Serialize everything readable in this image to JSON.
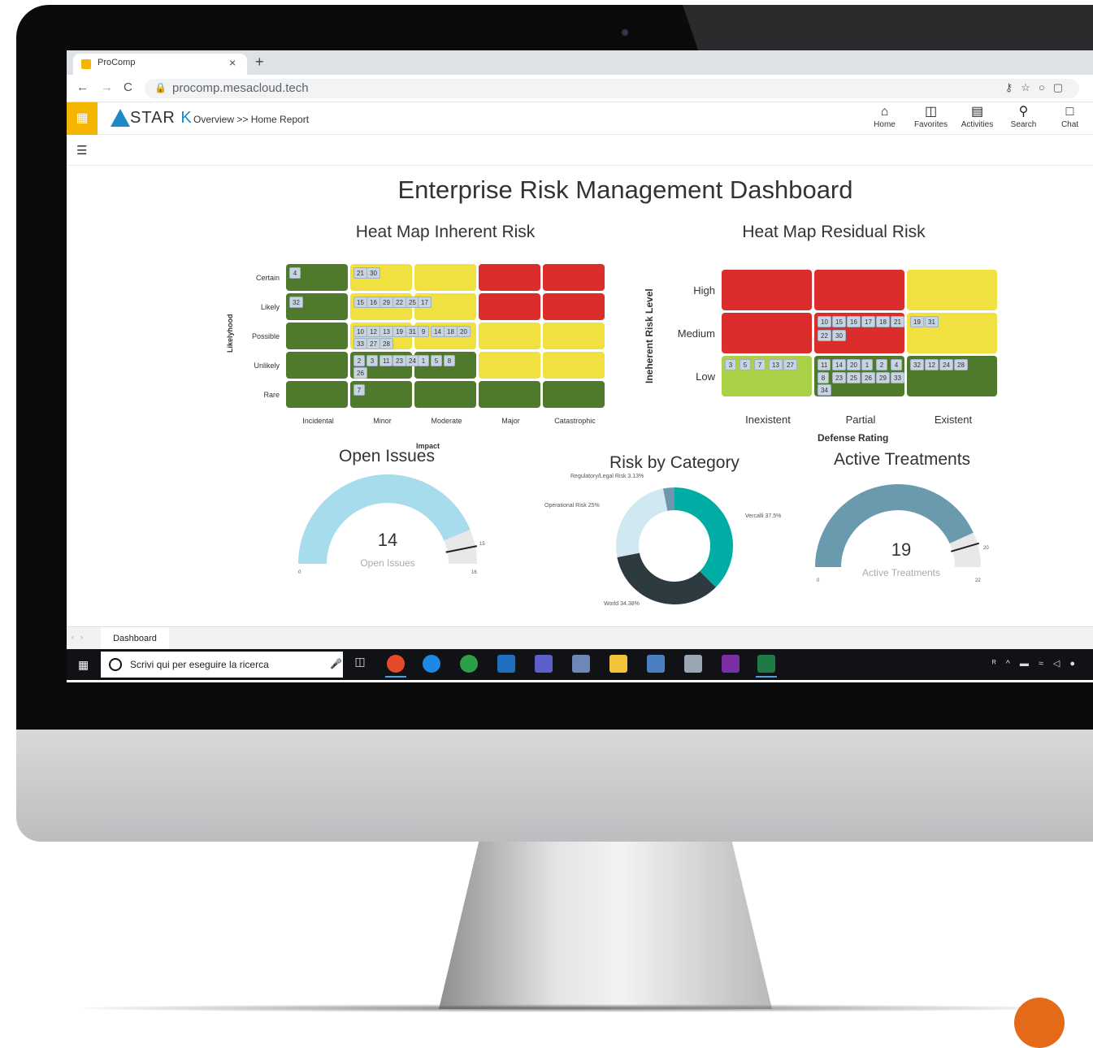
{
  "browser": {
    "tab_title": "ProComp",
    "tab_close": "×",
    "new_tab": "+",
    "url": "procomp.mesacloud.tech"
  },
  "app": {
    "logo_text": "STAR",
    "logo_k": "K",
    "breadcrumb": "Overview >> Home Report",
    "nav": [
      {
        "label": "Home",
        "icon": "home-icon"
      },
      {
        "label": "Favorites",
        "icon": "favorites-icon"
      },
      {
        "label": "Activities",
        "icon": "activities-icon"
      },
      {
        "label": "Search",
        "icon": "search-icon"
      },
      {
        "label": "Chat",
        "icon": "chat-icon"
      }
    ]
  },
  "dashboard": {
    "title": "Enterprise Risk Management Dashboard",
    "inherent": {
      "title": "Heat Map Inherent Risk",
      "y_axis_title": "Likelyhood",
      "x_axis_title": "Impact",
      "rows": [
        "Certain",
        "Likely",
        "Possible",
        "Unlikely",
        "Rare"
      ],
      "cols": [
        "Incidental",
        "Minor",
        "Moderate",
        "Major",
        "Catastrophic"
      ]
    },
    "residual": {
      "title": "Heat Map Residual Risk",
      "y_axis_title": "Ineherent Risk Level",
      "x_axis_title": "Defense Rating",
      "rows": [
        "High",
        "Medium",
        "Low"
      ],
      "cols": [
        "Inexistent",
        "Partial",
        "Existent"
      ]
    },
    "open_issues": {
      "title": "Open Issues",
      "value": "14",
      "label": "Open Issues",
      "min": "0",
      "max": "16",
      "target": "15"
    },
    "risk_by_category": {
      "title": "Risk by Category",
      "labels": [
        "Regulatory/Legal Risk 3.13%",
        "Operational Risk 25%",
        "Vercalli 37.5%",
        "World 34.38%"
      ]
    },
    "active_treatments": {
      "title": "Active Treatments",
      "value": "19",
      "label": "Active Treatments",
      "min": "0",
      "max": "22",
      "target": "20"
    }
  },
  "sheet_tab": "Dashboard",
  "taskbar": {
    "search_placeholder": "Scrivi qui per eseguire la ricerca"
  },
  "colors": {
    "green": "#4f7a2c",
    "yellow": "#f0e140",
    "red": "#dc2d2d",
    "lightgreen": "#a9d148",
    "accent": "#f5b400"
  },
  "chart_data": [
    {
      "type": "heatmap",
      "title": "Heat Map Inherent Risk",
      "xlabel": "Impact",
      "ylabel": "Likelyhood",
      "x": [
        "Incidental",
        "Minor",
        "Moderate",
        "Major",
        "Catastrophic"
      ],
      "y": [
        "Certain",
        "Likely",
        "Possible",
        "Unlikely",
        "Rare"
      ],
      "levels": [
        [
          "green",
          "yellow",
          "yellow",
          "red",
          "red"
        ],
        [
          "green",
          "yellow",
          "yellow",
          "red",
          "red"
        ],
        [
          "green",
          "yellow",
          "yellow",
          "yellow",
          "yellow"
        ],
        [
          "green",
          "green",
          "green",
          "yellow",
          "yellow"
        ],
        [
          "green",
          "green",
          "green",
          "green",
          "green"
        ]
      ],
      "cells": [
        {
          "row": "Certain",
          "col": "Incidental",
          "ids": [
            "4"
          ]
        },
        {
          "row": "Certain",
          "col": "Minor",
          "ids": [
            "21",
            "30"
          ]
        },
        {
          "row": "Likely",
          "col": "Incidental",
          "ids": [
            "32"
          ]
        },
        {
          "row": "Likely",
          "col": "Minor",
          "ids": [
            "15",
            "16",
            "29",
            "22",
            "25"
          ]
        },
        {
          "row": "Likely",
          "col": "Moderate",
          "ids": [
            "17"
          ]
        },
        {
          "row": "Possible",
          "col": "Minor",
          "ids": [
            "10",
            "12",
            "13",
            "19",
            "31",
            "33",
            "27",
            "28"
          ]
        },
        {
          "row": "Possible",
          "col": "Moderate",
          "ids": [
            "9",
            "14",
            "18",
            "20"
          ]
        },
        {
          "row": "Unlikely",
          "col": "Minor",
          "ids": [
            "2",
            "3",
            "11",
            "23",
            "24",
            "26"
          ]
        },
        {
          "row": "Unlikely",
          "col": "Moderate",
          "ids": [
            "1",
            "5",
            "8"
          ]
        },
        {
          "row": "Rare",
          "col": "Minor",
          "ids": [
            "7"
          ]
        }
      ]
    },
    {
      "type": "heatmap",
      "title": "Heat Map Residual Risk",
      "xlabel": "Defense Rating",
      "ylabel": "Ineherent Risk Level",
      "x": [
        "Inexistent",
        "Partial",
        "Existent"
      ],
      "y": [
        "High",
        "Medium",
        "Low"
      ],
      "levels": [
        [
          "red",
          "red",
          "yellow"
        ],
        [
          "red",
          "red",
          "yellow"
        ],
        [
          "lightgreen",
          "green",
          "green"
        ]
      ],
      "cells": [
        {
          "row": "Medium",
          "col": "Partial",
          "ids": [
            "10",
            "15",
            "16",
            "17",
            "18",
            "21",
            "22",
            "30"
          ]
        },
        {
          "row": "Medium",
          "col": "Existent",
          "ids": [
            "19",
            "31"
          ]
        },
        {
          "row": "Low",
          "col": "Inexistent",
          "ids": [
            "3",
            "5",
            "7",
            "13",
            "27"
          ]
        },
        {
          "row": "Low",
          "col": "Partial",
          "ids": [
            "11",
            "14",
            "20",
            "1",
            "2",
            "4",
            "8",
            "23",
            "25",
            "26",
            "29",
            "33",
            "34"
          ]
        },
        {
          "row": "Low",
          "col": "Existent",
          "ids": [
            "32",
            "12",
            "24",
            "28"
          ]
        }
      ]
    },
    {
      "type": "gauge",
      "title": "Open Issues",
      "value": 14,
      "min": 0,
      "max": 16,
      "target": 15
    },
    {
      "type": "pie",
      "title": "Risk by Category",
      "donut": true,
      "categories": [
        "Vercalli",
        "World",
        "Operational Risk",
        "Regulatory/Legal Risk"
      ],
      "values": [
        37.5,
        34.38,
        25,
        3.13
      ],
      "colors": [
        "#00ada4",
        "#2d3a3f",
        "#cfe8f2",
        "#6e97ad"
      ]
    },
    {
      "type": "gauge",
      "title": "Active Treatments",
      "value": 19,
      "min": 0,
      "max": 22,
      "target": 20
    }
  ]
}
